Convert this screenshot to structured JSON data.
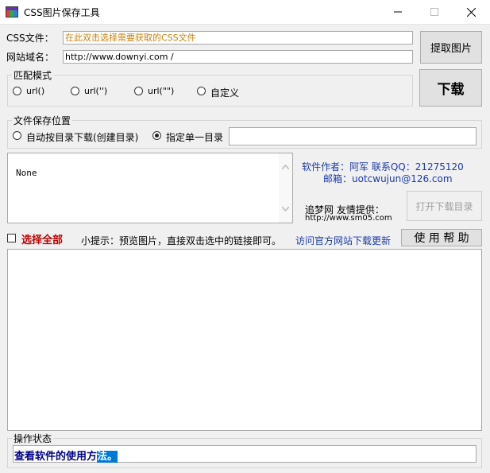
{
  "window": {
    "title": "CSS图片保存工具",
    "icon": "app-icon",
    "controls": [
      "minimize-icon",
      "maximize-icon",
      "close-icon"
    ]
  },
  "form": {
    "css_file_label": "CSS文件：",
    "css_file_placeholder": "在此双击选择需要获取的CSS文件",
    "site_domain_label": "网站域名：",
    "site_domain_value": "http://www.downyi.com /"
  },
  "buttons": {
    "extract": "提取图片",
    "download": "下载",
    "open_dir": "打开下载目录",
    "help": "使 用 帮 助"
  },
  "match_mode": {
    "title": "匹配模式",
    "options": [
      "url()",
      "url('')",
      "url(\"\")",
      "自定义"
    ]
  },
  "save_location": {
    "title": "文件保存位置",
    "option_auto": "自动按目录下载(创建目录)",
    "option_single": "指定单一目录",
    "selected": "option_single",
    "dir_value": ""
  },
  "log_box": {
    "text": "None"
  },
  "author": {
    "line1": "软件作者：阿军  联系QQ：21275120",
    "line2": "邮箱：uotcwujun@126.com",
    "sponsor": "追梦网 友情提供：",
    "sponsor_url": "http://www.sm05.com"
  },
  "toolbar": {
    "select_all": "选择全部",
    "tip": "小提示：预览图片，直接双击选中的链接即可。",
    "official_link": "访问官方网站下载更新"
  },
  "status": {
    "title": "操作状态",
    "text_normal": "查看软件的使用方",
    "text_selected": "法。"
  },
  "colors": {
    "placeholder": "#c87f0a",
    "select_all": "#c00000",
    "author_text": "#1b3aa6",
    "selection": "#0078d7",
    "status_text": "#00008b"
  }
}
